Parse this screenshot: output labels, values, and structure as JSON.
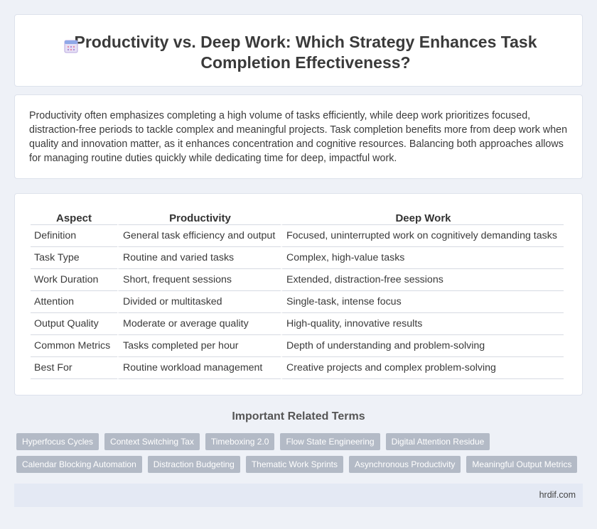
{
  "header": {
    "title": "Productivity vs. Deep Work: Which Strategy Enhances Task Completion Effectiveness?",
    "icon": "calendar-icon"
  },
  "intro": {
    "text": "Productivity often emphasizes completing a high volume of tasks efficiently, while deep work prioritizes focused, distraction-free periods to tackle complex and meaningful projects. Task completion benefits more from deep work when quality and innovation matter, as it enhances concentration and cognitive resources. Balancing both approaches allows for managing routine duties quickly while dedicating time for deep, impactful work."
  },
  "table": {
    "headers": [
      "Aspect",
      "Productivity",
      "Deep Work"
    ],
    "rows": [
      [
        "Definition",
        "General task efficiency and output",
        "Focused, uninterrupted work on cognitively demanding tasks"
      ],
      [
        "Task Type",
        "Routine and varied tasks",
        "Complex, high-value tasks"
      ],
      [
        "Work Duration",
        "Short, frequent sessions",
        "Extended, distraction-free sessions"
      ],
      [
        "Attention",
        "Divided or multitasked",
        "Single-task, intense focus"
      ],
      [
        "Output Quality",
        "Moderate or average quality",
        "High-quality, innovative results"
      ],
      [
        "Common Metrics",
        "Tasks completed per hour",
        "Depth of understanding and problem-solving"
      ],
      [
        "Best For",
        "Routine workload management",
        "Creative projects and complex problem-solving"
      ]
    ]
  },
  "related": {
    "heading": "Important Related Terms",
    "tags_row1": [
      "Hyperfocus Cycles",
      "Context Switching Tax",
      "Timeboxing 2.0",
      "Flow State Engineering",
      "Digital Attention Residue"
    ],
    "tags_row2": [
      "Calendar Blocking Automation",
      "Distraction Budgeting",
      "Thematic Work Sprints",
      "Asynchronous Productivity",
      "Meaningful Output Metrics"
    ]
  },
  "footer": {
    "site": "hrdif.com"
  },
  "colors": {
    "background": "#eef1f7",
    "tag": "#b3bac6",
    "footer": "#e4e9f4"
  }
}
